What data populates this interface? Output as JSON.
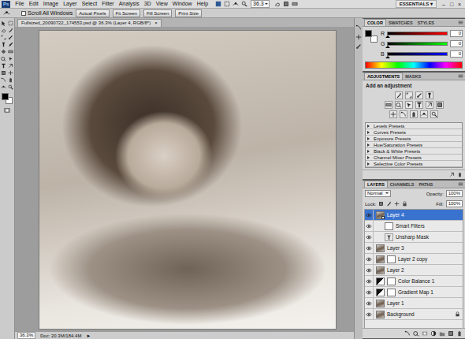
{
  "menu_bar": {
    "logo": "Ps",
    "items": [
      "File",
      "Edit",
      "Image",
      "Layer",
      "Select",
      "Filter",
      "Analysis",
      "3D",
      "View",
      "Window",
      "Help"
    ],
    "zoom": "36.3",
    "workspace": "ESSENTIALS ▾",
    "window_controls": [
      "–",
      "□",
      "×"
    ]
  },
  "options_bar": {
    "scroll_all": {
      "label": "Scroll All Windows",
      "checked": false
    },
    "buttons": [
      "Actual Pixels",
      "Fit Screen",
      "Fill Screen",
      "Print Size"
    ]
  },
  "document": {
    "tab": "Fullsized_20090722_174553.psd @ 36.3% (Layer 4, RGB/8*)",
    "close": "×",
    "zoom": "36.3%",
    "doc_info": "Doc: 20.3M/184.4M",
    "arrow": "►"
  },
  "color_panel": {
    "tabs": [
      {
        "label": "COLOR",
        "selected": true
      },
      {
        "label": "SWATCHES",
        "selected": false
      },
      {
        "label": "STYLES",
        "selected": false
      }
    ],
    "channels": [
      {
        "name": "R",
        "value": "0",
        "level": 0,
        "color": "#ff0000"
      },
      {
        "name": "G",
        "value": "0",
        "level": 0,
        "color": "#00ff00"
      },
      {
        "name": "B",
        "value": "0",
        "level": 0,
        "color": "#0000ff"
      }
    ]
  },
  "adjustments_panel": {
    "tabs": [
      {
        "label": "ADJUSTMENTS",
        "selected": true
      },
      {
        "label": "MASKS",
        "selected": false
      }
    ],
    "heading": "Add an adjustment",
    "presets": [
      {
        "label": "Levels Presets",
        "expanded": false
      },
      {
        "label": "Curves Presets",
        "expanded": false
      },
      {
        "label": "Exposure Presets",
        "expanded": false
      },
      {
        "label": "Hue/Saturation Presets",
        "expanded": false
      },
      {
        "label": "Black & White Presets",
        "expanded": false
      },
      {
        "label": "Channel Mixer Presets",
        "expanded": false
      },
      {
        "label": "Selective Color Presets",
        "expanded": false
      }
    ]
  },
  "layers_panel": {
    "tabs": [
      {
        "label": "LAYERS",
        "selected": true
      },
      {
        "label": "CHANNELS",
        "selected": false
      },
      {
        "label": "PATHS",
        "selected": false
      }
    ],
    "blend_mode": "Normal",
    "opacity_label": "Opacity:",
    "opacity": "100%",
    "lock_label": "Lock:",
    "fill_label": "Fill:",
    "fill": "100%",
    "layers": [
      {
        "name": "Layer 4",
        "kind": "smart",
        "selected": true,
        "visible": true,
        "mask": false
      },
      {
        "name": "Smart Filters",
        "kind": "filter-group",
        "selected": false,
        "visible": true,
        "mask": true
      },
      {
        "name": "Unsharp Mask",
        "kind": "filter",
        "selected": false,
        "visible": true,
        "mask": false
      },
      {
        "name": "Layer 3",
        "kind": "pixel",
        "selected": false,
        "visible": true,
        "mask": false
      },
      {
        "name": "Layer 2 copy",
        "kind": "pixel",
        "selected": false,
        "visible": true,
        "mask": true
      },
      {
        "name": "Layer 2",
        "kind": "pixel",
        "selected": false,
        "visible": true,
        "mask": false
      },
      {
        "name": "Color Balance 1",
        "kind": "adjustment",
        "selected": false,
        "visible": true,
        "mask": true
      },
      {
        "name": "Gradient Map 1",
        "kind": "adjustment",
        "selected": false,
        "visible": true,
        "mask": true
      },
      {
        "name": "Layer 1",
        "kind": "pixel",
        "selected": false,
        "visible": true,
        "mask": false
      },
      {
        "name": "Background",
        "kind": "background",
        "selected": false,
        "visible": true,
        "mask": false
      }
    ]
  }
}
